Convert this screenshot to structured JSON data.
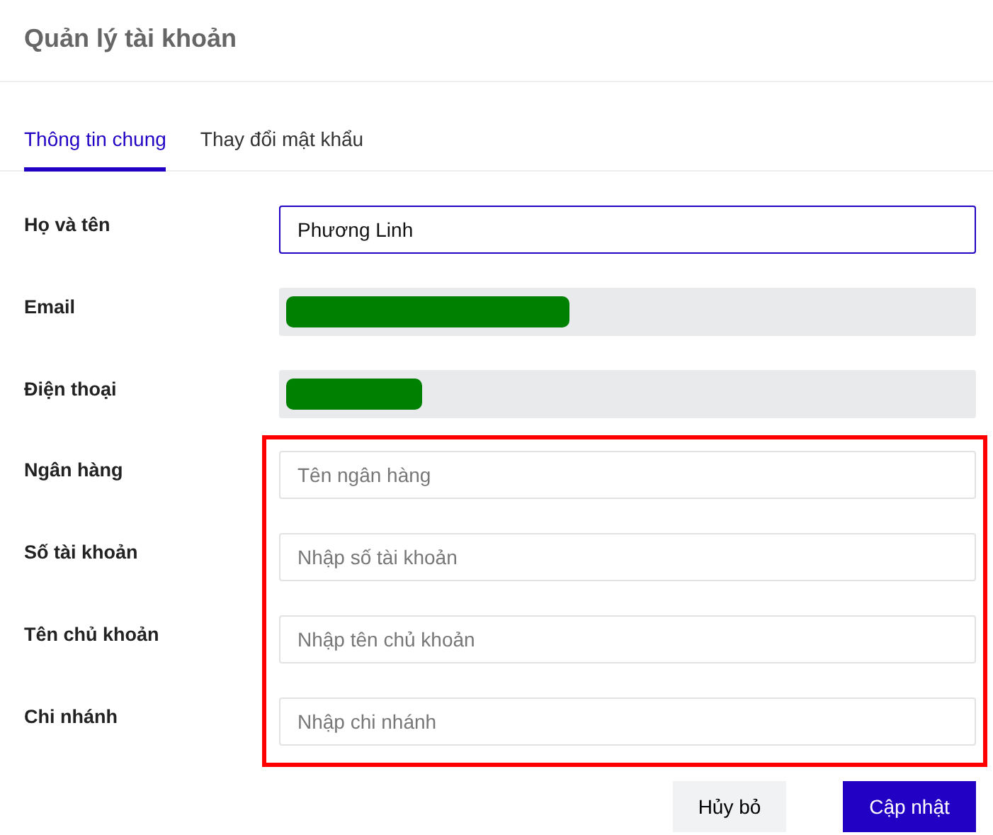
{
  "title": "Quản lý tài khoản",
  "tabs": [
    {
      "label": "Thông tin chung",
      "selected": true
    },
    {
      "label": "Thay đổi mật khẩu",
      "selected": false
    }
  ],
  "fields": [
    {
      "label": "Họ và tên",
      "kind": "text",
      "value": "Phương Linh",
      "focused": true
    },
    {
      "label": "Email",
      "kind": "redacted",
      "disabled": true
    },
    {
      "label": "Điện thoại",
      "kind": "redacted",
      "disabled": true
    }
  ],
  "bank_section": {
    "highlighted": true,
    "fields": [
      {
        "label": "Ngân hàng",
        "kind": "text",
        "placeholder": "Tên ngân hàng",
        "focused": false
      },
      {
        "label": "Số tài khoản",
        "kind": "text",
        "placeholder": "Nhập số tài khoản",
        "focused": false
      },
      {
        "label": "Tên chủ khoản",
        "kind": "text",
        "placeholder": "Nhập tên chủ khoản",
        "focused": false
      },
      {
        "label": "Chi nhánh",
        "kind": "text",
        "placeholder": "Nhập chi nhánh",
        "focused": false
      }
    ]
  },
  "buttons": [
    {
      "label": "Hủy bỏ",
      "kind": "secondary"
    },
    {
      "label": "Cập nhật",
      "kind": "primary"
    }
  ]
}
